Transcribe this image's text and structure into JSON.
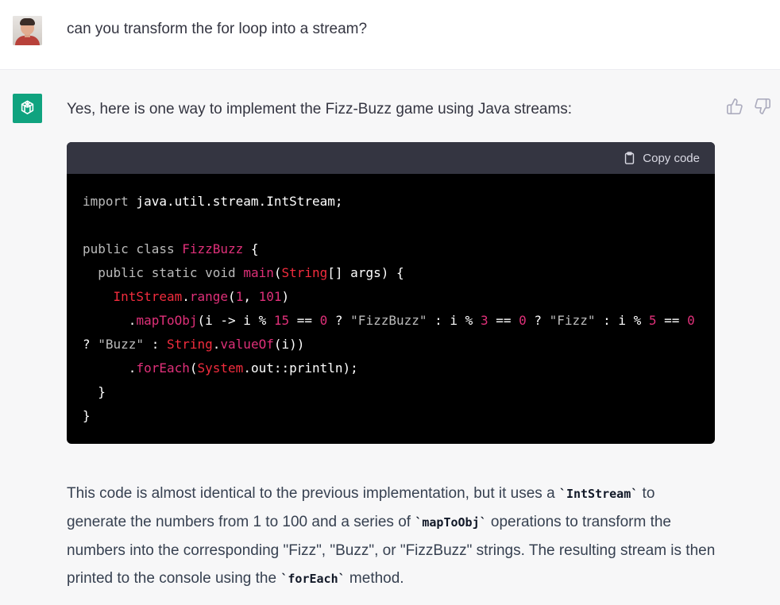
{
  "user": {
    "message": "can you transform the for loop into a stream?"
  },
  "assistant": {
    "intro": "Yes, here is one way to implement the Fizz-Buzz game using Java streams:",
    "copy_label": "Copy code",
    "code": {
      "l1_kw": "import",
      "l1_rest": " java.util.stream.IntStream;",
      "l3_kw": "public class",
      "l3_cls": "FizzBuzz",
      "l3_rest": " {",
      "l4_kw": "public static",
      "l4_void": "void",
      "l4_main": "main",
      "l4_paren": "(",
      "l4_string": "String",
      "l4_rest": "[] args) {",
      "l5_intstream": "IntStream",
      "l5_dot": ".",
      "l5_range": "range",
      "l5_open": "(",
      "l5_n1": "1",
      "l5_comma": ", ",
      "l5_n2": "101",
      "l5_close": ")",
      "l6_dot": ".",
      "l6_method": "mapToObj",
      "l6_a": "(i -> i % ",
      "l6_n15": "15",
      "l6_b": " == ",
      "l6_n0a": "0",
      "l6_c": " ? ",
      "l6_s1": "\"FizzBuzz\"",
      "l6_d": " : i % ",
      "l6_n3": "3",
      "l6_e": " == ",
      "l6_n0b": "0",
      "l6_f": " ? ",
      "l6_s2": "\"Fizz\"",
      "l6_g": " : i % ",
      "l6_n5": "5",
      "l6_h": " == ",
      "l6_n0c": "0",
      "l7_a": "? ",
      "l7_s": "\"Buzz\"",
      "l7_b": " : ",
      "l7_string": "String",
      "l7_dot": ".",
      "l7_valueof": "valueOf",
      "l7_rest": "(i))",
      "l8_dot": ".",
      "l8_foreach": "forEach",
      "l8_open": "(",
      "l8_system": "System",
      "l8_rest": ".out::println);",
      "l9": "}",
      "l10": "}"
    },
    "paragraph": {
      "p1": "This code is almost identical to the previous implementation, but it uses a ",
      "c1": "`IntStream`",
      "p2": " to generate the numbers from 1 to 100 and a series of ",
      "c2": "`mapToObj`",
      "p3": " operations to transform the numbers into the corresponding \"Fizz\", \"Buzz\", or \"FizzBuzz\" strings. The resulting stream is then printed to the console using the ",
      "c3": "`forEach`",
      "p4": " method."
    }
  },
  "colors": {
    "code_bg": "#000000",
    "code_header": "#343541",
    "keyword": "#bbbbbb",
    "class_name": "#f22c3d",
    "accent_pink": "#df3079",
    "bot_green": "#10a37f"
  },
  "icons": {
    "user_avatar": "user-photo",
    "bot_avatar": "openai-logo-icon",
    "copy": "clipboard-icon",
    "like": "thumbs-up-icon",
    "dislike": "thumbs-down-icon"
  }
}
